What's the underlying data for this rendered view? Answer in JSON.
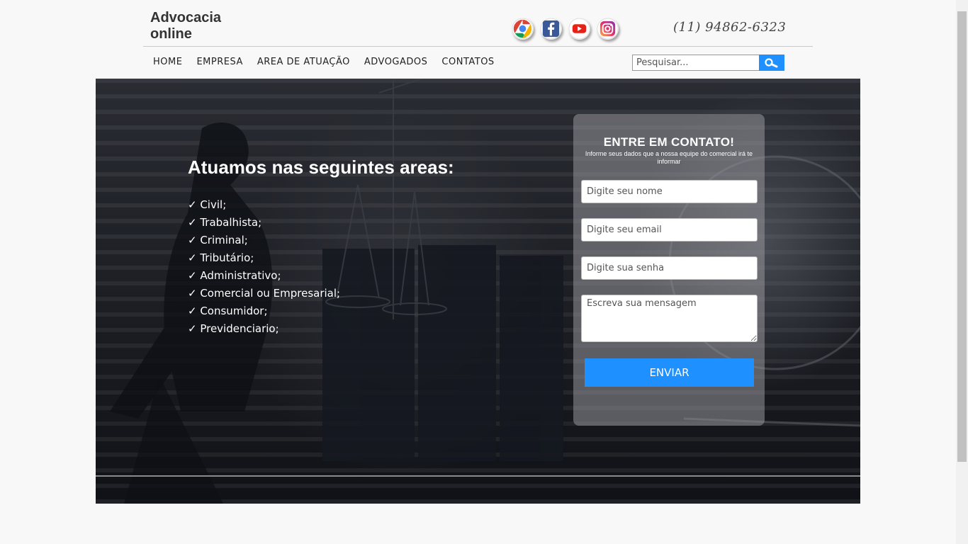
{
  "brand": {
    "logo_line1": "Advocacia",
    "logo_line2": "online"
  },
  "social": [
    {
      "name": "chrome-icon",
      "color": "#4285f4"
    },
    {
      "name": "facebook-icon",
      "color": "#3b5998"
    },
    {
      "name": "youtube-icon",
      "color": "#e62117"
    },
    {
      "name": "instagram-icon",
      "color": "#c13584"
    }
  ],
  "phone": "(11) 94862-6323",
  "nav": {
    "items": [
      "HOME",
      "EMPRESA",
      "AREA DE ATUAÇÃO",
      "ADVOGADOS",
      "CONTATOS"
    ]
  },
  "search": {
    "placeholder": "Pesquisar..."
  },
  "hero": {
    "title": "Atuamos nas seguintes areas:",
    "areas": [
      "✓ Civil;",
      "✓ Trabalhista;",
      "✓ Criminal;",
      "✓ Tributário;",
      "✓ Administrativo;",
      "✓ Comercial ou Empresarial;",
      "✓ Consumidor;",
      "✓ Previdenciario;"
    ]
  },
  "contact_form": {
    "title": "ENTRE EM CONTATO!",
    "subtitle": "Informe seus dados que a nossa equipe do comercial irá te informar",
    "name_placeholder": "Digite seu nome",
    "email_placeholder": "Digite seu email",
    "password_placeholder": "Digite sua senha",
    "message_placeholder": "Escreva sua mensagem",
    "submit_label": "ENVIAR"
  },
  "colors": {
    "accent": "#1e90ff",
    "text_dark": "#333333",
    "background": "#f8f8f8"
  }
}
